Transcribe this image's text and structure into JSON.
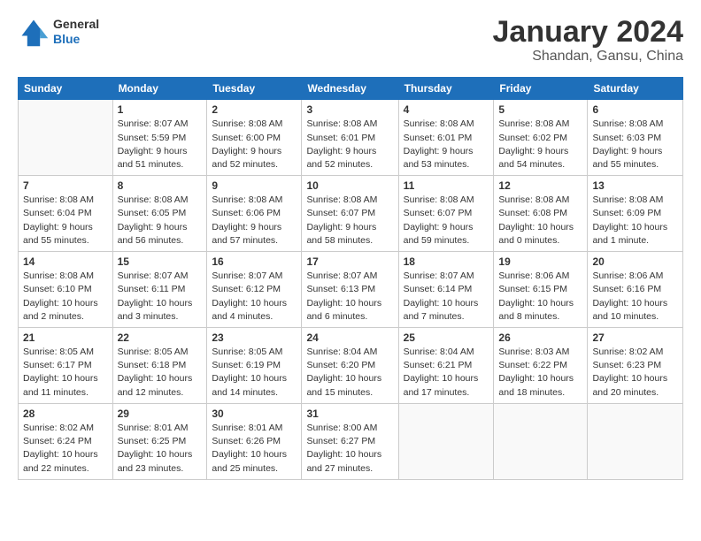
{
  "header": {
    "logo": {
      "general": "General",
      "blue": "Blue"
    },
    "title": "January 2024",
    "location": "Shandan, Gansu, China"
  },
  "days_of_week": [
    "Sunday",
    "Monday",
    "Tuesday",
    "Wednesday",
    "Thursday",
    "Friday",
    "Saturday"
  ],
  "weeks": [
    [
      {
        "day": "",
        "info": ""
      },
      {
        "day": "1",
        "info": "Sunrise: 8:07 AM\nSunset: 5:59 PM\nDaylight: 9 hours\nand 51 minutes."
      },
      {
        "day": "2",
        "info": "Sunrise: 8:08 AM\nSunset: 6:00 PM\nDaylight: 9 hours\nand 52 minutes."
      },
      {
        "day": "3",
        "info": "Sunrise: 8:08 AM\nSunset: 6:01 PM\nDaylight: 9 hours\nand 52 minutes."
      },
      {
        "day": "4",
        "info": "Sunrise: 8:08 AM\nSunset: 6:01 PM\nDaylight: 9 hours\nand 53 minutes."
      },
      {
        "day": "5",
        "info": "Sunrise: 8:08 AM\nSunset: 6:02 PM\nDaylight: 9 hours\nand 54 minutes."
      },
      {
        "day": "6",
        "info": "Sunrise: 8:08 AM\nSunset: 6:03 PM\nDaylight: 9 hours\nand 55 minutes."
      }
    ],
    [
      {
        "day": "7",
        "info": "Sunrise: 8:08 AM\nSunset: 6:04 PM\nDaylight: 9 hours\nand 55 minutes."
      },
      {
        "day": "8",
        "info": "Sunrise: 8:08 AM\nSunset: 6:05 PM\nDaylight: 9 hours\nand 56 minutes."
      },
      {
        "day": "9",
        "info": "Sunrise: 8:08 AM\nSunset: 6:06 PM\nDaylight: 9 hours\nand 57 minutes."
      },
      {
        "day": "10",
        "info": "Sunrise: 8:08 AM\nSunset: 6:07 PM\nDaylight: 9 hours\nand 58 minutes."
      },
      {
        "day": "11",
        "info": "Sunrise: 8:08 AM\nSunset: 6:07 PM\nDaylight: 9 hours\nand 59 minutes."
      },
      {
        "day": "12",
        "info": "Sunrise: 8:08 AM\nSunset: 6:08 PM\nDaylight: 10 hours\nand 0 minutes."
      },
      {
        "day": "13",
        "info": "Sunrise: 8:08 AM\nSunset: 6:09 PM\nDaylight: 10 hours\nand 1 minute."
      }
    ],
    [
      {
        "day": "14",
        "info": "Sunrise: 8:08 AM\nSunset: 6:10 PM\nDaylight: 10 hours\nand 2 minutes."
      },
      {
        "day": "15",
        "info": "Sunrise: 8:07 AM\nSunset: 6:11 PM\nDaylight: 10 hours\nand 3 minutes."
      },
      {
        "day": "16",
        "info": "Sunrise: 8:07 AM\nSunset: 6:12 PM\nDaylight: 10 hours\nand 4 minutes."
      },
      {
        "day": "17",
        "info": "Sunrise: 8:07 AM\nSunset: 6:13 PM\nDaylight: 10 hours\nand 6 minutes."
      },
      {
        "day": "18",
        "info": "Sunrise: 8:07 AM\nSunset: 6:14 PM\nDaylight: 10 hours\nand 7 minutes."
      },
      {
        "day": "19",
        "info": "Sunrise: 8:06 AM\nSunset: 6:15 PM\nDaylight: 10 hours\nand 8 minutes."
      },
      {
        "day": "20",
        "info": "Sunrise: 8:06 AM\nSunset: 6:16 PM\nDaylight: 10 hours\nand 10 minutes."
      }
    ],
    [
      {
        "day": "21",
        "info": "Sunrise: 8:05 AM\nSunset: 6:17 PM\nDaylight: 10 hours\nand 11 minutes."
      },
      {
        "day": "22",
        "info": "Sunrise: 8:05 AM\nSunset: 6:18 PM\nDaylight: 10 hours\nand 12 minutes."
      },
      {
        "day": "23",
        "info": "Sunrise: 8:05 AM\nSunset: 6:19 PM\nDaylight: 10 hours\nand 14 minutes."
      },
      {
        "day": "24",
        "info": "Sunrise: 8:04 AM\nSunset: 6:20 PM\nDaylight: 10 hours\nand 15 minutes."
      },
      {
        "day": "25",
        "info": "Sunrise: 8:04 AM\nSunset: 6:21 PM\nDaylight: 10 hours\nand 17 minutes."
      },
      {
        "day": "26",
        "info": "Sunrise: 8:03 AM\nSunset: 6:22 PM\nDaylight: 10 hours\nand 18 minutes."
      },
      {
        "day": "27",
        "info": "Sunrise: 8:02 AM\nSunset: 6:23 PM\nDaylight: 10 hours\nand 20 minutes."
      }
    ],
    [
      {
        "day": "28",
        "info": "Sunrise: 8:02 AM\nSunset: 6:24 PM\nDaylight: 10 hours\nand 22 minutes."
      },
      {
        "day": "29",
        "info": "Sunrise: 8:01 AM\nSunset: 6:25 PM\nDaylight: 10 hours\nand 23 minutes."
      },
      {
        "day": "30",
        "info": "Sunrise: 8:01 AM\nSunset: 6:26 PM\nDaylight: 10 hours\nand 25 minutes."
      },
      {
        "day": "31",
        "info": "Sunrise: 8:00 AM\nSunset: 6:27 PM\nDaylight: 10 hours\nand 27 minutes."
      },
      {
        "day": "",
        "info": ""
      },
      {
        "day": "",
        "info": ""
      },
      {
        "day": "",
        "info": ""
      }
    ]
  ]
}
